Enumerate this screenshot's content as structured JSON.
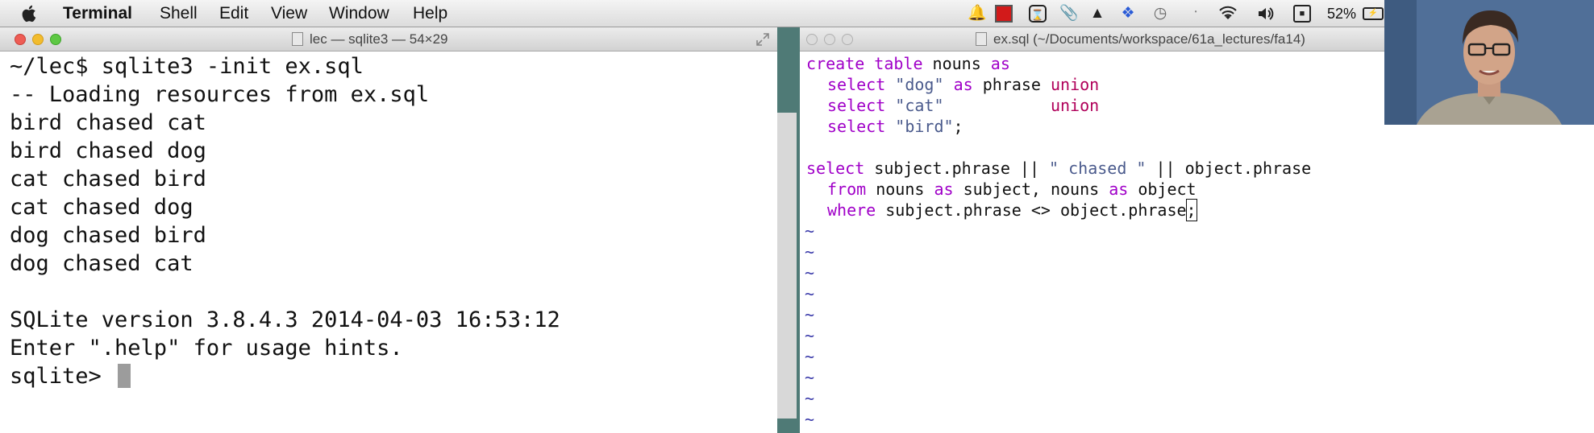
{
  "menubar": {
    "app_name": "Terminal",
    "items": [
      "Shell",
      "Edit",
      "View",
      "Window",
      "Help"
    ],
    "battery": "52%",
    "tray_icons": [
      "notification-icon",
      "record-icon",
      "hourglass-icon",
      "paperclip-icon",
      "drive-icon",
      "dropbox-icon",
      "time-machine-icon",
      "bluetooth-icon",
      "wifi-icon",
      "volume-icon",
      "display-icon",
      "battery-icon"
    ]
  },
  "terminal": {
    "title": "lec — sqlite3 — 54×29",
    "lines": [
      "~/lec$ sqlite3 -init ex.sql",
      "-- Loading resources from ex.sql",
      "bird chased cat",
      "bird chased dog",
      "cat chased bird",
      "cat chased dog",
      "dog chased bird",
      "dog chased cat",
      "",
      "SQLite version 3.8.4.3 2014-04-03 16:53:12",
      "Enter \".help\" for usage hints."
    ],
    "prompt": "sqlite> "
  },
  "editor": {
    "title": "ex.sql (~/Documents/workspace/61a_lectures/fa14)",
    "tilde": "~",
    "code": {
      "l1_kw1": "create table",
      "l1_mid": " nouns ",
      "l1_kw2": "as",
      "l2_kw1": "select",
      "l2_str": "\"dog\"",
      "l2_kw2": "as",
      "l2_mid": " phrase ",
      "l2_kw3": "union",
      "l3_kw1": "select",
      "l3_str": "\"cat\"",
      "l3_kw3": "union",
      "l4_kw1": "select",
      "l4_str": "\"bird\"",
      "l4_end": ";",
      "l5_kw1": "select",
      "l5_mid": " subject.phrase || ",
      "l5_str": "\" chased \"",
      "l5_end": " || object.phrase",
      "l6_kw1": "from",
      "l6_mid": " nouns ",
      "l6_kw2": "as",
      "l6_mid2": " subject, nouns ",
      "l6_kw3": "as",
      "l6_end": " object",
      "l7_kw1": "where",
      "l7_mid": " subject.phrase <> object.phrase",
      "l7_end": ";"
    }
  },
  "colors": {
    "keyword": "#a000c8",
    "keyword_alt": "#b0005a",
    "string": "#4a5a8c",
    "tilde": "#3a3aaa"
  }
}
